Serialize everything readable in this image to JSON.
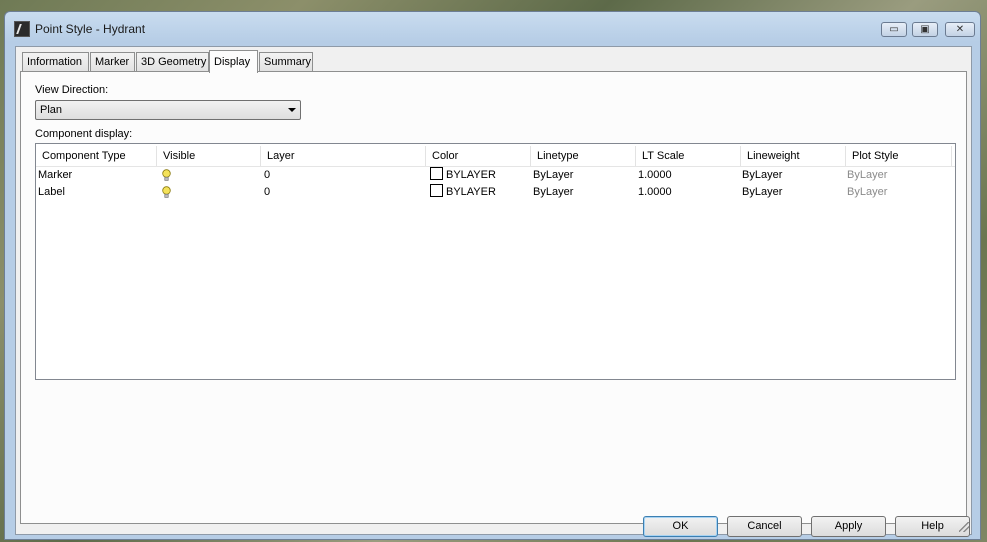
{
  "window": {
    "title": "Point Style - Hydrant",
    "controls": {
      "minimize": "▭",
      "maximize": "▣",
      "close": "✕"
    }
  },
  "tabs": [
    {
      "label": "Information"
    },
    {
      "label": "Marker"
    },
    {
      "label": "3D Geometry"
    },
    {
      "label": "Display",
      "active": true
    },
    {
      "label": "Summary"
    }
  ],
  "display": {
    "view_direction_label": "View Direction:",
    "view_direction_value": "Plan",
    "component_display_label": "Component display:",
    "columns": [
      "Component Type",
      "Visible",
      "Layer",
      "Color",
      "Linetype",
      "LT Scale",
      "Lineweight",
      "Plot Style"
    ],
    "rows": [
      {
        "component_type": "Marker",
        "visible": "lightbulb-on",
        "layer": "0",
        "color": "BYLAYER",
        "linetype": "ByLayer",
        "lt_scale": "1.0000",
        "lineweight": "ByLayer",
        "plot_style": "ByLayer"
      },
      {
        "component_type": "Label",
        "visible": "lightbulb-on",
        "layer": "0",
        "color": "BYLAYER",
        "linetype": "ByLayer",
        "lt_scale": "1.0000",
        "lineweight": "ByLayer",
        "plot_style": "ByLayer"
      }
    ]
  },
  "buttons": {
    "ok": "OK",
    "cancel": "Cancel",
    "apply": "Apply",
    "help": "Help"
  },
  "colors": {
    "bulb": "#f4e25a",
    "title_bar": "#b6cde6",
    "default_button_border": "#3c7fb1"
  }
}
